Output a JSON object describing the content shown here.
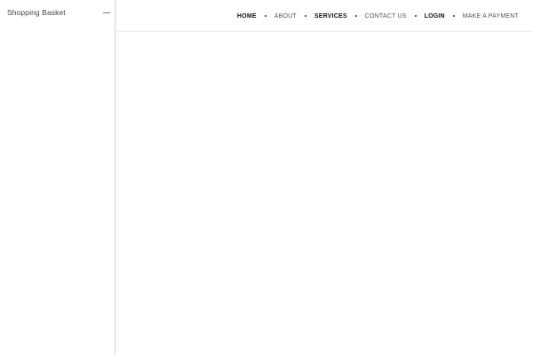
{
  "sidebar": {
    "basket_label": "Shopping Basket",
    "toggle_icon": "minus-icon"
  },
  "nav": {
    "items": [
      {
        "label": "HOME"
      },
      {
        "label": "ABOUT"
      },
      {
        "label": "SERVICES"
      },
      {
        "label": "CONTACT US"
      },
      {
        "label": "LOGIN"
      },
      {
        "label": "MAKE A PAYMENT"
      }
    ],
    "separator_icon": "bullet-dot-icon"
  },
  "colors": {
    "text": "#3a3a3a",
    "nav_text": "#555555",
    "nav_text_strong": "#111111",
    "divider": "#d9d9d9",
    "background": "#ffffff"
  }
}
